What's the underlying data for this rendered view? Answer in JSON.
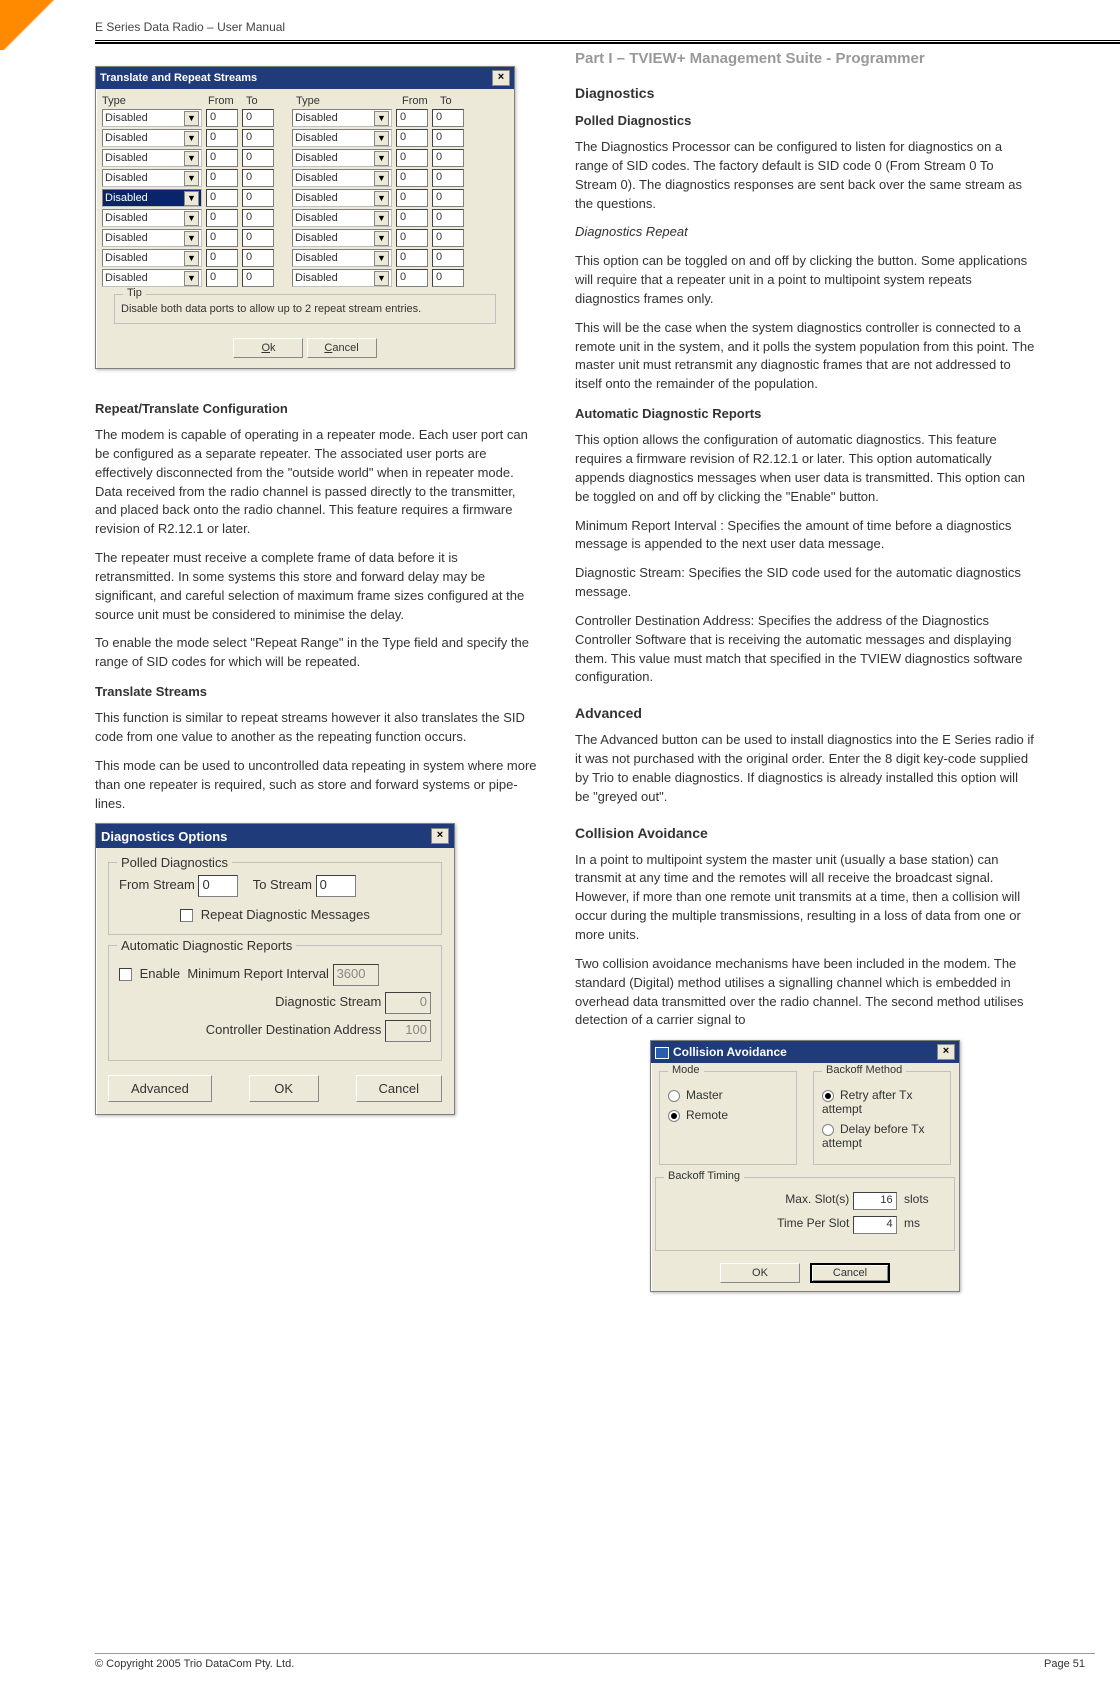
{
  "header": "E Series Data Radio – User Manual",
  "part_title": "Part I – TVIEW+ Management Suite - Programmer",
  "footer": {
    "copyright": "© Copyright 2005 Trio DataCom Pty. Ltd.",
    "page": "Page 51"
  },
  "dlg_streams": {
    "title": "Translate and Repeat Streams",
    "headers": {
      "type": "Type",
      "from": "From",
      "to": "To"
    },
    "rows": [
      {
        "l_type": "Disabled",
        "l_from": "0",
        "l_to": "0",
        "r_type": "Disabled",
        "r_from": "0",
        "r_to": "0"
      },
      {
        "l_type": "Disabled",
        "l_from": "0",
        "l_to": "0",
        "r_type": "Disabled",
        "r_from": "0",
        "r_to": "0"
      },
      {
        "l_type": "Disabled",
        "l_from": "0",
        "l_to": "0",
        "r_type": "Disabled",
        "r_from": "0",
        "r_to": "0"
      },
      {
        "l_type": "Disabled",
        "l_from": "0",
        "l_to": "0",
        "r_type": "Disabled",
        "r_from": "0",
        "r_to": "0"
      },
      {
        "l_type": "Disabled",
        "l_from": "0",
        "l_to": "0",
        "r_type": "Disabled",
        "r_from": "0",
        "r_to": "0",
        "selected": true
      },
      {
        "l_type": "Disabled",
        "l_from": "0",
        "l_to": "0",
        "r_type": "Disabled",
        "r_from": "0",
        "r_to": "0"
      },
      {
        "l_type": "Disabled",
        "l_from": "0",
        "l_to": "0",
        "r_type": "Disabled",
        "r_from": "0",
        "r_to": "0"
      },
      {
        "l_type": "Disabled",
        "l_from": "0",
        "l_to": "0",
        "r_type": "Disabled",
        "r_from": "0",
        "r_to": "0"
      },
      {
        "l_type": "Disabled",
        "l_from": "0",
        "l_to": "0",
        "r_type": "Disabled",
        "r_from": "0",
        "r_to": "0"
      }
    ],
    "tip_label": "Tip",
    "tip": "Disable both data ports to allow up to 2 repeat stream entries.",
    "ok": "Ok",
    "cancel": "Cancel"
  },
  "text": {
    "repeat_heading": "Repeat/Translate Configuration",
    "repeat_p1": "The modem is capable of operating in a repeater mode.  Each user port can be configured as a separate repeater.  The associated user ports are effectively disconnected from the \"outside world\" when in repeater mode.  Data received from the radio channel is passed directly to the transmitter, and placed back onto the radio channel. This feature requires a firmware revision of R2.12.1 or later.",
    "repeat_p2": "The repeater must receive a complete frame of data before it is retransmitted.  In some systems this store and forward delay may be significant, and careful selection of maximum frame sizes configured at the source unit must be considered to minimise the delay.",
    "repeat_p3": "To enable the mode select \"Repeat Range\" in the Type field and specify the range of SID codes for which will be repeated.",
    "translate_heading": "Translate Streams",
    "translate_p1": "This function is similar to repeat streams however it also translates the SID code from one value to another as the repeating function occurs.",
    "translate_p2": "This mode can be used to uncontrolled data repeating in system where more than one repeater is required, such as store and forward systems or pipe-lines.",
    "diagnostics_h": "Diagnostics",
    "polled_h": "Polled Diagnostics",
    "polled_p": "The Diagnostics Processor can be configured to listen for diagnostics on a range of SID codes. The factory default is SID code 0 (From Stream 0 To Stream 0). The diagnostics responses are sent back over the same stream as the questions.",
    "diag_repeat_h": "Diagnostics Repeat",
    "diag_repeat_p1": "This option can be toggled on and off by clicking the button. Some applications will require that a repeater unit in a point to multipoint system repeats diagnostics frames only.",
    "diag_repeat_p2": "This will be the case when the system diagnostics controller is connected to a remote unit in the system, and it polls the system population from this point.  The master unit must retransmit any diagnostic frames that are not addressed to itself onto the remainder of the population.",
    "auto_h": "Automatic Diagnostic Reports",
    "auto_p1": "This option allows the configuration of automatic diagnostics. This feature requires a firmware revision of R2.12.1 or later. This option automatically appends diagnostics messages when user data is transmitted. This option can be toggled on and off by clicking the \"Enable\" button.",
    "auto_p2": "Minimum Report Interval : Specifies the amount of time before a diagnostics message is appended to the next user data message.",
    "auto_p3": "Diagnostic Stream: Specifies the SID code used for the automatic diagnostics message.",
    "auto_p4": "Controller Destination Address: Specifies the address of the Diagnostics Controller Software that is receiving the automatic messages and displaying them. This value must match that specified in the TVIEW diagnostics software configuration.",
    "advanced_h": "Advanced",
    "advanced_p": "The Advanced button can be used to install diagnostics into the E Series radio if it was not purchased with the original order. Enter the 8 digit key-code supplied by Trio to enable diagnostics. If diagnostics is already installed this option will be \"greyed out\".",
    "collision_h": "Collision Avoidance",
    "collision_p1": "In a point to multipoint system the master unit (usually a base station) can transmit at any time and the remotes will all receive the broadcast signal.  However, if more than one remote unit transmits at a time, then a collision will occur during the multiple transmissions, resulting in a loss of data from one or more units.",
    "collision_p2": "Two collision avoidance mechanisms have been included in the modem.  The standard (Digital) method utilises a signalling channel which is embedded in overhead data transmitted over the radio channel. The second method utilises detection of a carrier signal to"
  },
  "dlg_diag": {
    "title": "Diagnostics Options",
    "polled_legend": "Polled Diagnostics",
    "from_label": "From Stream",
    "from_val": "0",
    "to_label": "To Stream",
    "to_val": "0",
    "repeat_label": "Repeat Diagnostic Messages",
    "auto_legend": "Automatic Diagnostic Reports",
    "enable_label": "Enable",
    "min_interval_label": "Minimum Report Interval",
    "min_interval_val": "3600",
    "stream_label": "Diagnostic Stream",
    "stream_val": "0",
    "ctrl_addr_label": "Controller Destination Address",
    "ctrl_addr_val": "100",
    "advanced": "Advanced",
    "ok": "OK",
    "cancel": "Cancel"
  },
  "dlg_coll": {
    "title": "Collision Avoidance",
    "mode_legend": "Mode",
    "mode_master": "Master",
    "mode_remote": "Remote",
    "backoff_legend": "Backoff Method",
    "backoff_retry": "Retry after Tx attempt",
    "backoff_delay": "Delay before Tx attempt",
    "timing_legend": "Backoff Timing",
    "max_slot_label": "Max. Slot(s)",
    "max_slot_val": "16",
    "slots_unit": "slots",
    "time_label": "Time Per Slot",
    "time_val": "4",
    "ms_unit": "ms",
    "ok": "OK",
    "cancel": "Cancel"
  }
}
